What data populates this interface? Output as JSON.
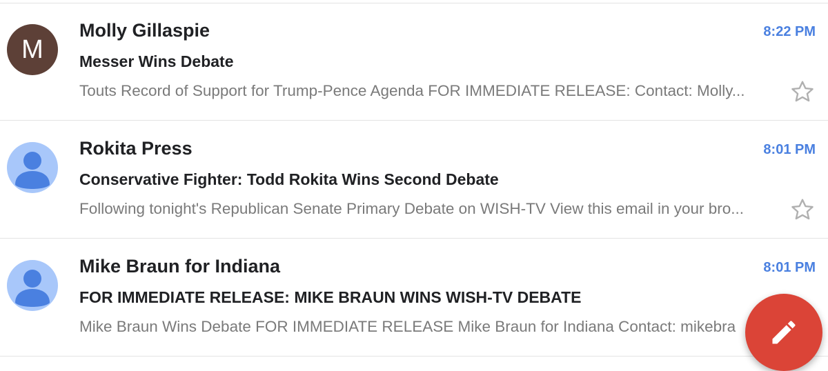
{
  "emails": [
    {
      "avatar_type": "letter",
      "avatar_letter": "M",
      "avatar_color": "#5d4037",
      "sender": "Molly Gillaspie",
      "time": "8:22 PM",
      "subject": "Messer Wins Debate",
      "snippet": "Touts Record of Support for Trump-Pence Agenda FOR IMMEDIATE RELEASE: Contact: Molly...",
      "starred": false
    },
    {
      "avatar_type": "person-icon",
      "avatar_color": "#a8c7fa",
      "sender": "Rokita Press",
      "time": "8:01 PM",
      "subject": "Conservative Fighter: Todd Rokita Wins Second Debate",
      "snippet": "Following tonight's Republican Senate Primary Debate on WISH-TV View this email in your bro...",
      "starred": false
    },
    {
      "avatar_type": "person-icon",
      "avatar_color": "#a8c7fa",
      "sender": "Mike Braun for Indiana",
      "time": "8:01 PM",
      "subject": "FOR IMMEDIATE RELEASE: MIKE BRAUN WINS WISH-TV DEBATE",
      "snippet": "Mike Braun Wins Debate FOR IMMEDIATE RELEASE Mike Braun for Indiana Contact: mikebra",
      "starred": false
    }
  ],
  "compose_button": {
    "icon": "pencil-icon",
    "color": "#db4437"
  },
  "colors": {
    "time": "#4a80e0",
    "snippet": "#7a7a7a",
    "sender": "#202124"
  }
}
